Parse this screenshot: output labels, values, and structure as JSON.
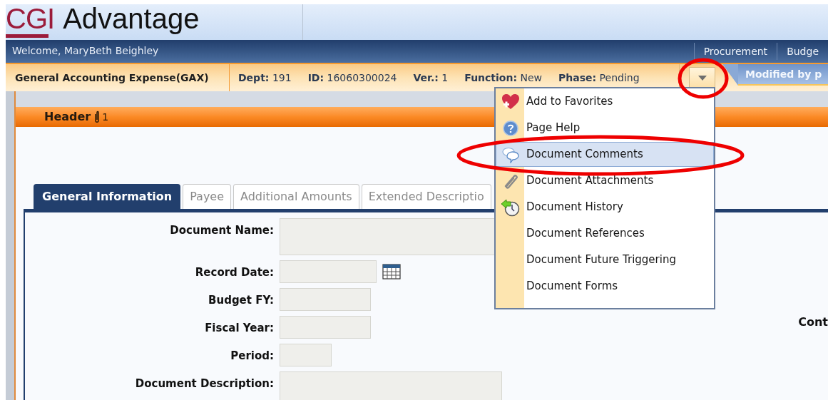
{
  "logo": {
    "mark": "CGI",
    "name": "Advantage"
  },
  "welcome": "Welcome, MaryBeth Beighley",
  "nav_links": [
    "Procurement",
    "Budge"
  ],
  "document_bar": {
    "title": "General Accounting Expense(GAX)",
    "fields": [
      {
        "label": "Dept:",
        "value": "191"
      },
      {
        "label": "ID:",
        "value": "16060300024"
      },
      {
        "label": "Ver.:",
        "value": "1"
      },
      {
        "label": "Function:",
        "value": "New"
      },
      {
        "label": "Phase:",
        "value": "Pending"
      }
    ],
    "status_tab": "Modified by p"
  },
  "section": {
    "title": "Header",
    "attachment_count": "1"
  },
  "tabs": [
    {
      "label": "General Information",
      "selected": true
    },
    {
      "label": "Payee",
      "selected": false
    },
    {
      "label": "Additional Amounts",
      "selected": false
    },
    {
      "label": "Extended Descriptio",
      "selected": false
    }
  ],
  "form_fields": [
    {
      "label": "Document Name:",
      "kind": "textarea"
    },
    {
      "label": "Record Date:",
      "kind": "date"
    },
    {
      "label": "Budget FY:",
      "kind": "text"
    },
    {
      "label": "Fiscal Year:",
      "kind": "text"
    },
    {
      "label": "Period:",
      "kind": "small"
    },
    {
      "label": "Document Description:",
      "kind": "textarea"
    }
  ],
  "side_label": "Cont",
  "menu": {
    "items": [
      {
        "label": "Add to Favorites",
        "selected": false
      },
      {
        "label": "Page Help",
        "selected": false
      },
      {
        "label": "Document Comments",
        "selected": true
      },
      {
        "label": "Document Attachments",
        "selected": false
      },
      {
        "label": "Document History",
        "selected": false
      },
      {
        "label": "Document References",
        "selected": false
      },
      {
        "label": "Document Future Triggering",
        "selected": false
      },
      {
        "label": "Document Forms",
        "selected": false
      }
    ]
  }
}
